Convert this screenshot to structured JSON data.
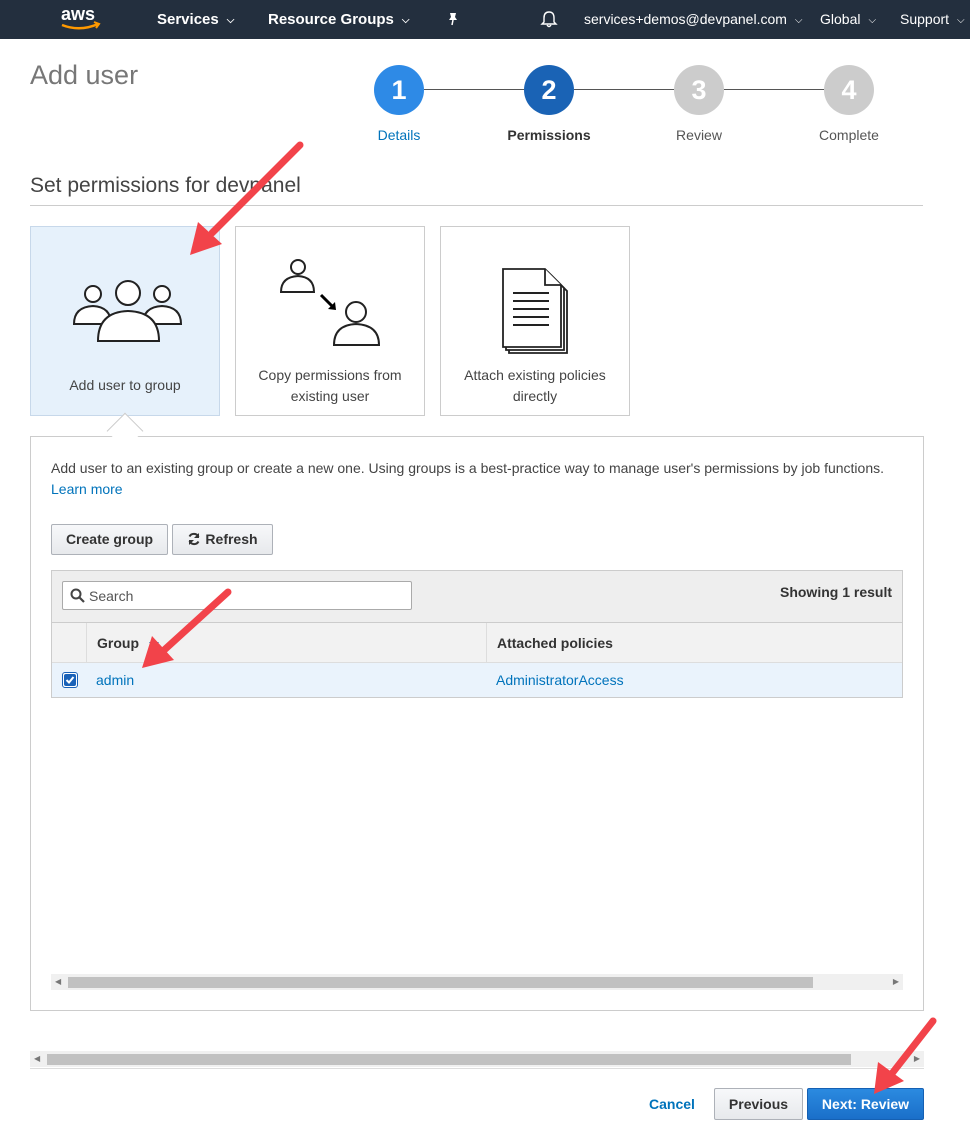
{
  "nav": {
    "services": "Services",
    "resource_groups": "Resource Groups",
    "account": "services+demos@devpanel.com",
    "region": "Global",
    "support": "Support",
    "logo_text": "aws"
  },
  "page": {
    "title": "Add user"
  },
  "wizard": {
    "steps": [
      {
        "number": "1",
        "label": "Details",
        "state": "done"
      },
      {
        "number": "2",
        "label": "Permissions",
        "state": "current"
      },
      {
        "number": "3",
        "label": "Review",
        "state": "pending"
      },
      {
        "number": "4",
        "label": "Complete",
        "state": "pending"
      }
    ]
  },
  "permissions": {
    "heading": "Set permissions for devpanel",
    "options": [
      {
        "line1": "Add user to group",
        "line2": "",
        "selected": true,
        "icon": "group-icon"
      },
      {
        "line1": "Copy permissions from",
        "line2": "existing user",
        "selected": false,
        "icon": "copy-user-icon"
      },
      {
        "line1": "Attach existing policies",
        "line2": "directly",
        "selected": false,
        "icon": "document-icon"
      }
    ],
    "description": "Add user to an existing group or create a new one. Using groups is a best-practice way to manage user's permissions by job functions.",
    "learn_more": "Learn more"
  },
  "toolbar": {
    "create_group": "Create group",
    "refresh": "Refresh"
  },
  "table": {
    "search_placeholder": "Search",
    "showing": "Showing 1 result",
    "columns": [
      "Group",
      "Attached policies"
    ],
    "rows": [
      {
        "group": "admin",
        "policies": "AdministratorAccess",
        "checked": true
      }
    ]
  },
  "footer": {
    "cancel": "Cancel",
    "previous": "Previous",
    "next": "Next: Review"
  },
  "colors": {
    "nav_bg": "#232f3e",
    "step_done": "#2e8ae6",
    "step_current": "#1a63b5",
    "step_pending": "#cccccc",
    "link": "#0073bb",
    "annotation_arrow": "#f2434a"
  }
}
